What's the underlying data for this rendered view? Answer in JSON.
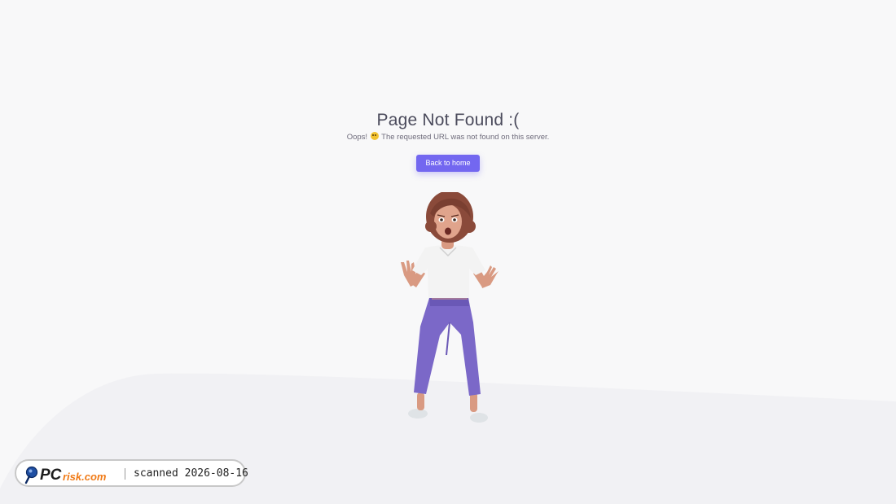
{
  "error_page": {
    "title": "Page Not Found :(",
    "subtitle_prefix": "Oops!",
    "subtitle_emoji": "weary-face-emoji",
    "subtitle_suffix": "The requested URL was not found on this server.",
    "back_button_label": "Back to home",
    "illustration": "surprised-woman-3d-illustration"
  },
  "watermark": {
    "logo_text": "PCrisk.com",
    "scan_text": "scanned 2026-08-16"
  },
  "colors": {
    "background": "#f8f8f9",
    "accent": "#7367f0",
    "title_text": "#4b4b5c",
    "subtitle_text": "#6e6b7b"
  }
}
